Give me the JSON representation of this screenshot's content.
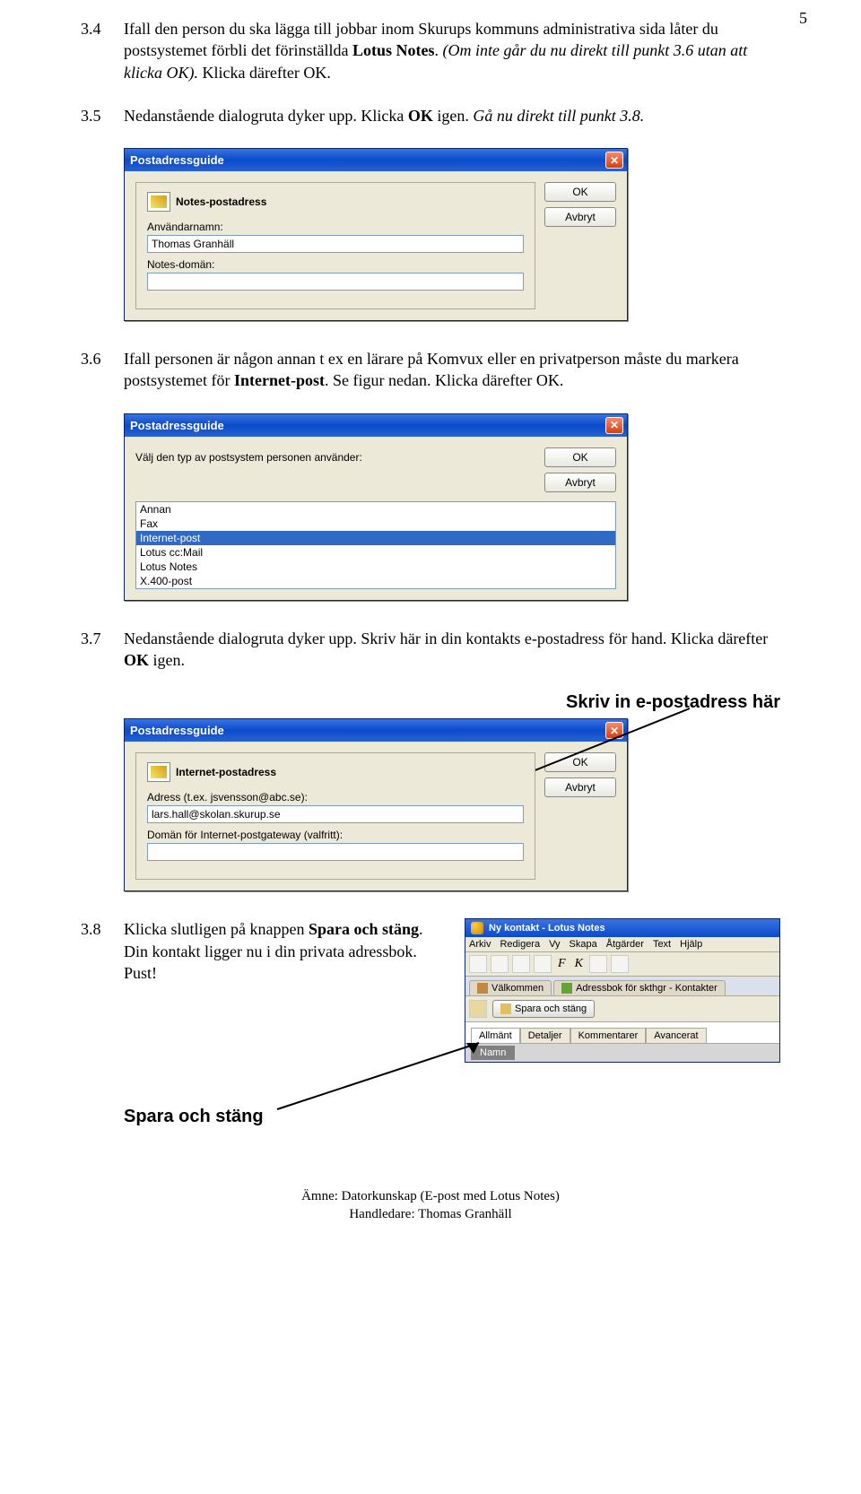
{
  "page_number": "5",
  "para34": {
    "num": "3.4",
    "text_a": "Ifall den person du ska lägga till jobbar inom Skurups kommuns administrativa sida låter du postsystemet förbli det förinställda ",
    "bold_b": "Lotus Notes",
    "text_c": ". ",
    "italic_d": "(Om inte går du nu direkt till punkt 3.6 utan att klicka OK).",
    "text_e": " Klicka därefter OK."
  },
  "para35": {
    "num": "3.5",
    "text_a": "Nedanstående dialogruta dyker upp. Klicka ",
    "bold_b": "OK",
    "text_c": " igen. ",
    "italic_d": "Gå nu direkt till punkt 3.8."
  },
  "dialog1": {
    "title": "Postadressguide",
    "group_title": "Notes-postadress",
    "label1": "Användarnamn:",
    "value1": "Thomas Granhäll",
    "label2": "Notes-domän:",
    "value2": "",
    "ok": "OK",
    "cancel": "Avbryt"
  },
  "para36": {
    "num": "3.6",
    "text_a": "Ifall personen är någon annan t ex en lärare på Komvux eller en privatperson måste du markera postsystemet för ",
    "bold_b": "Internet-post",
    "text_c": ". Se figur nedan. Klicka därefter OK."
  },
  "dialog2": {
    "title": "Postadressguide",
    "prompt": "Välj den typ av postsystem personen använder:",
    "items": [
      "Annan",
      "Fax",
      "Internet-post",
      "Lotus cc:Mail",
      "Lotus Notes",
      "X.400-post"
    ],
    "selected_index": 2,
    "ok": "OK",
    "cancel": "Avbryt"
  },
  "para37": {
    "num": "3.7",
    "text_a": "Nedanstående dialogruta dyker upp. Skriv här in din kontakts e-postadress för hand. Klicka därefter ",
    "bold_b": "OK",
    "text_c": " igen."
  },
  "callout1": "Skriv in e-postadress här",
  "dialog3": {
    "title": "Postadressguide",
    "group_title": "Internet-postadress",
    "label1": "Adress (t.ex. jsvensson@abc.se):",
    "value1": "lars.hall@skolan.skurup.se",
    "label2": "Domän för Internet-postgateway (valfritt):",
    "value2": "",
    "ok": "OK",
    "cancel": "Avbryt"
  },
  "para38": {
    "num": "3.8",
    "text_a": "Klicka slutligen på knappen ",
    "bold_b": "Spara och stäng",
    "text_c": ". Din kontakt ligger nu i din privata adressbok. Pust!"
  },
  "notes_window": {
    "title": "Ny kontakt - Lotus Notes",
    "menus": [
      "Arkiv",
      "Redigera",
      "Vy",
      "Skapa",
      "Åtgärder",
      "Text",
      "Hjälp"
    ],
    "tab1": "Välkommen",
    "tab2": "Adressbok för skthgr - Kontakter",
    "save_btn": "Spara och stäng",
    "form_tabs": [
      "Allmänt",
      "Detaljer",
      "Kommentarer",
      "Avancerat"
    ],
    "form_label": "Namn"
  },
  "callout2": "Spara och stäng",
  "footer": {
    "line1": "Ämne: Datorkunskap (E-post med Lotus Notes)",
    "line2": "Handledare: Thomas Granhäll"
  }
}
